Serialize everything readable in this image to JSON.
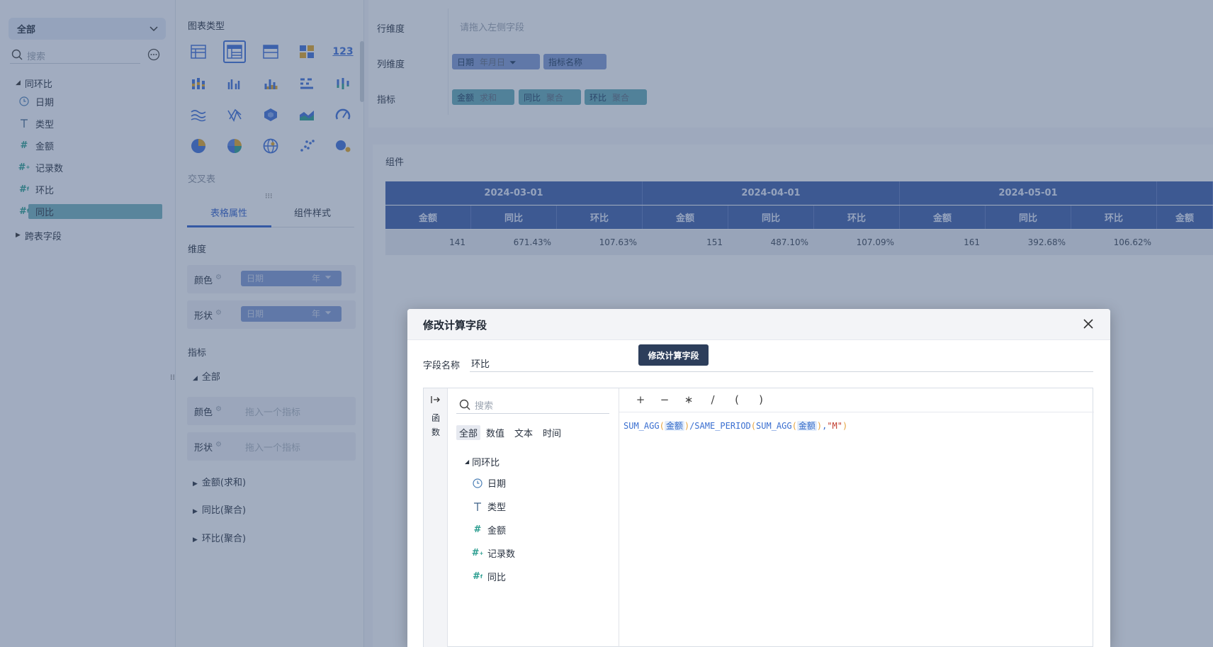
{
  "left": {
    "select_label": "全部",
    "search_placeholder": "搜索",
    "group": "同环比",
    "fields": [
      {
        "icon": "clock-icon",
        "label": "日期"
      },
      {
        "icon": "text-type-icon",
        "label": "类型"
      },
      {
        "icon": "number-icon",
        "label": "金额"
      },
      {
        "icon": "number-calc-icon",
        "label": "记录数"
      },
      {
        "icon": "number-calc-icon",
        "label": "环比"
      },
      {
        "icon": "number-calc-icon",
        "label": "同比"
      }
    ],
    "cross_fields": "跨表字段"
  },
  "mid": {
    "chart_type_title": "图表类型",
    "chart_icons": [
      "table-icon",
      "cross-table-icon",
      "detail-table-icon",
      "grid-icon",
      "kpi-123-icon",
      "bar-stack-icon",
      "bar-group-icon",
      "column-icon",
      "bar-horizontal-icon",
      "column-diverge-icon",
      "wave-icon",
      "radar-line-icon",
      "hexagon-icon",
      "area-icon",
      "gauge-icon",
      "pie-icon",
      "donut-icon",
      "globe-icon",
      "scatter-icon",
      "bubble-icon"
    ],
    "kpi_text": "123",
    "cross_table_label": "交叉表",
    "tabs": [
      "表格属性",
      "组件样式"
    ],
    "dimension_title": "维度",
    "dim_rows": [
      {
        "label": "颜色",
        "pill": "日期",
        "pill_sub": "年"
      },
      {
        "label": "形状",
        "pill": "日期",
        "pill_sub": "年"
      }
    ],
    "measure_title": "指标",
    "measure_group": "全部",
    "measure_rows": [
      {
        "label": "颜色",
        "hint": "拖入一个指标"
      },
      {
        "label": "形状",
        "hint": "拖入一个指标"
      }
    ],
    "measure_items": [
      "金额(求和)",
      "同比(聚合)",
      "环比(聚合)"
    ]
  },
  "right": {
    "row_dim_label": "行维度",
    "row_dim_placeholder": "请拖入左侧字段",
    "col_dim_label": "列维度",
    "col_pills": [
      {
        "name": "日期",
        "sub": "年月日"
      },
      {
        "name": "指标名称",
        "sub": ""
      }
    ],
    "measure_label": "指标",
    "measure_pills": [
      {
        "name": "金额",
        "sub": "求和"
      },
      {
        "name": "同比",
        "sub": "聚合"
      },
      {
        "name": "环比",
        "sub": "聚合"
      }
    ],
    "component_label": "组件",
    "table": {
      "dates": [
        "2024-03-01",
        "2024-04-01",
        "2024-05-01"
      ],
      "sub_headers": [
        "金额",
        "同比",
        "环比"
      ],
      "values": [
        [
          "141",
          "671.43%",
          "107.63%"
        ],
        [
          "151",
          "487.10%",
          "107.09%"
        ],
        [
          "161",
          "392.68%",
          "106.62%"
        ]
      ],
      "trailing_header": "金额"
    }
  },
  "modal": {
    "title": "修改计算字段",
    "tooltip": "修改计算字段",
    "name_label": "字段名称",
    "name_value": "环比",
    "side_tab": "函数",
    "search_placeholder": "搜索",
    "filter_tabs": [
      "全部",
      "数值",
      "文本",
      "时间"
    ],
    "tree_group": "同环比",
    "tree_fields": [
      {
        "icon": "clock-icon",
        "label": "日期"
      },
      {
        "icon": "text-type-icon",
        "label": "类型"
      },
      {
        "icon": "number-icon",
        "label": "金额"
      },
      {
        "icon": "number-calc-icon",
        "label": "记录数"
      },
      {
        "icon": "number-calc-icon",
        "label": "同比"
      }
    ],
    "operators": [
      "+",
      "−",
      "∗",
      "/",
      "(",
      ")"
    ],
    "formula": {
      "fn1": "SUM_AGG",
      "field": "金额",
      "slash": "/",
      "fn2": "SAME_PERIOD",
      "str": "\"M\""
    }
  }
}
